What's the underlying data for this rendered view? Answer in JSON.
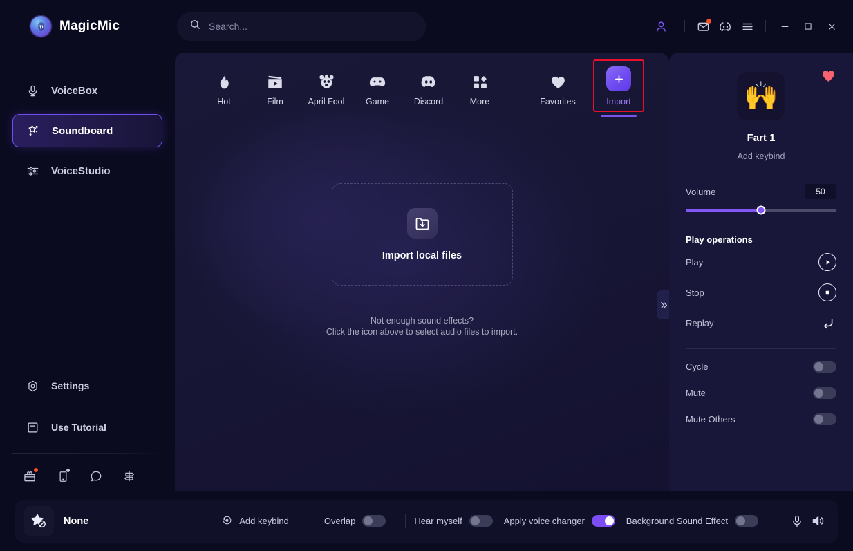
{
  "app": {
    "brand_name": "MagicMic",
    "brand_logo_icon": "magicmic-logo-icon"
  },
  "search": {
    "placeholder": "Search...",
    "value": "",
    "icon": "search-icon"
  },
  "titlebar": {
    "account_icon": "user-account-icon",
    "mail_icon": "mail-envelope-icon",
    "discord_icon": "discord-icon",
    "menu_icon": "hamburger-menu-icon",
    "minimize_icon": "minimize-icon",
    "maximize_icon": "maximize-icon",
    "close_icon": "close-icon"
  },
  "sidebar": {
    "items": [
      {
        "label": "VoiceBox",
        "icon": "microphone-icon",
        "active": false
      },
      {
        "label": "Soundboard",
        "icon": "magic-wand-star-icon",
        "active": true
      },
      {
        "label": "VoiceStudio",
        "icon": "sliders-icon",
        "active": false
      }
    ],
    "bottom_links": [
      {
        "label": "Settings",
        "icon": "gear-icon"
      },
      {
        "label": "Use Tutorial",
        "icon": "book-icon"
      }
    ],
    "footer_icons": [
      {
        "name": "gift-box-icon",
        "badge": "red-dot"
      },
      {
        "name": "mobile-device-icon",
        "badge": "white-dot"
      },
      {
        "name": "chat-bubble-icon",
        "badge": ""
      },
      {
        "name": "feedback-icon",
        "badge": ""
      }
    ]
  },
  "tabs": [
    {
      "label": "Hot",
      "icon": "flame-icon"
    },
    {
      "label": "Film",
      "icon": "clapperboard-icon"
    },
    {
      "label": "April Fool",
      "icon": "clown-face-icon"
    },
    {
      "label": "Game",
      "icon": "gamepad-icon"
    },
    {
      "label": "Discord",
      "icon": "discord-icon"
    },
    {
      "label": "More",
      "icon": "grid-blocks-icon"
    }
  ],
  "tabs_right": [
    {
      "label": "Favorites",
      "icon": "heart-icon",
      "active": false
    },
    {
      "label": "Import",
      "icon": "plus-icon",
      "active": true,
      "highlighted": true
    }
  ],
  "main": {
    "drop_title": "Import local files",
    "drop_icon": "folder-download-icon",
    "hint_line1": "Not enough sound effects?",
    "hint_line2": "Click the icon above to select audio files to import.",
    "collapse_icon": "chevron-double-right-icon"
  },
  "right_panel": {
    "favorite_icon": "heart-filled-icon",
    "avatar_emoji": "🙌",
    "sound_name": "Fart 1",
    "add_keybind": "Add keybind",
    "volume_label": "Volume",
    "volume_value": "50",
    "volume_percent": 50,
    "play_operations_title": "Play operations",
    "operations": [
      {
        "label": "Play",
        "icon": "play-icon"
      },
      {
        "label": "Stop",
        "icon": "stop-icon"
      },
      {
        "label": "Replay",
        "icon": "replay-arrow-icon"
      }
    ],
    "toggles": [
      {
        "label": "Cycle",
        "on": false
      },
      {
        "label": "Mute",
        "on": false
      },
      {
        "label": "Mute Others",
        "on": false
      }
    ]
  },
  "bottom_bar": {
    "voice_name": "None",
    "voice_icon": "star-slash-icon",
    "add_keybind": "Add keybind",
    "add_keybind_icon": "keybind-record-icon",
    "switches": [
      {
        "label": "Overlap",
        "on": false
      },
      {
        "label": "Hear myself",
        "on": false
      },
      {
        "label": "Apply voice changer",
        "on": true
      },
      {
        "label": "Background Sound Effect",
        "on": false
      }
    ],
    "mic_icon": "microphone-icon",
    "speaker_icon": "speaker-icon"
  },
  "colors": {
    "accent_purple": "#7b54f0",
    "highlight_red": "#e8102a",
    "favorite_pink": "#f4636f",
    "badge_red": "#f04e23"
  }
}
